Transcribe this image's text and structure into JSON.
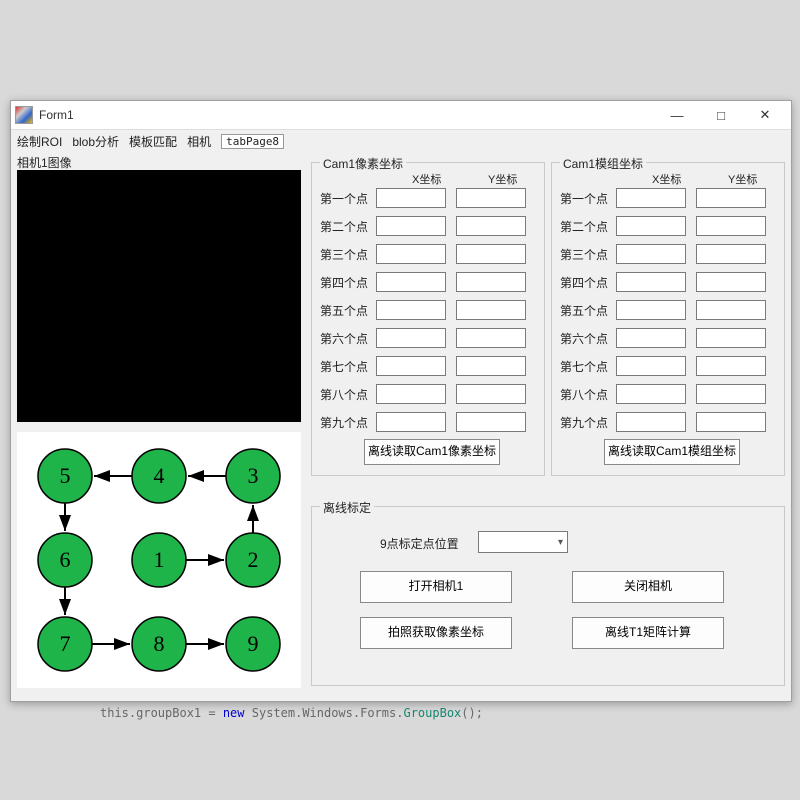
{
  "window": {
    "title": "Form1",
    "minimize": "—",
    "maximize": "□",
    "close": "✕"
  },
  "menu": {
    "roi": "绘制ROI",
    "blob": "blob分析",
    "template": "模板匹配",
    "camera": "相机",
    "tab": "tabPage8"
  },
  "labels": {
    "cam1_image": "相机1图像"
  },
  "pixel_group": {
    "title": "Cam1像素坐标",
    "x_header": "X坐标",
    "y_header": "Y坐标",
    "rows": [
      "第一个点",
      "第二个点",
      "第三个点",
      "第四个点",
      "第五个点",
      "第六个点",
      "第七个点",
      "第八个点",
      "第九个点"
    ],
    "read_button": "离线读取Cam1像素坐标"
  },
  "module_group": {
    "title": "Cam1模组坐标",
    "x_header": "X坐标",
    "y_header": "Y坐标",
    "rows": [
      "第一个点",
      "第二个点",
      "第三个点",
      "第四个点",
      "第五个点",
      "第六个点",
      "第七个点",
      "第八个点",
      "第九个点"
    ],
    "read_button": "离线读取Cam1模组坐标"
  },
  "offline_group": {
    "title": "离线标定",
    "nine_point_label": "9点标定点位置",
    "combo_value": "",
    "open_camera": "打开相机1",
    "close_camera": "关闭相机",
    "capture_pixel": "拍照获取像素坐标",
    "calc_matrix": "离线T1矩阵计算"
  },
  "diagram": {
    "nodes": [
      "1",
      "2",
      "3",
      "4",
      "5",
      "6",
      "7",
      "8",
      "9"
    ]
  },
  "code": {
    "prefix": "this.groupBox1 = ",
    "kw": "new",
    "mid": " System.Windows.Forms.",
    "cls": "GroupBox",
    "suffix": "();"
  }
}
